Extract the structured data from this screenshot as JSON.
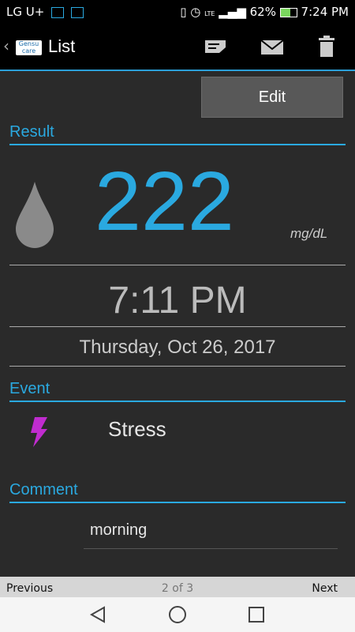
{
  "status_bar": {
    "carrier": "LG U+",
    "network": "LTE",
    "battery": "62%",
    "time": "7:24 PM"
  },
  "action_bar": {
    "back": "‹",
    "logo_line1": "Gensu",
    "logo_line2": "care",
    "title": "List"
  },
  "result": {
    "edit_label": "Edit",
    "header": "Result",
    "value": "222",
    "unit": "mg/dL",
    "time": "7:11 PM",
    "date": "Thursday, Oct 26, 2017"
  },
  "event": {
    "header": "Event",
    "label": "Stress"
  },
  "comment": {
    "header": "Comment",
    "text": "morning"
  },
  "pager": {
    "previous": "Previous",
    "position": "2 of 3",
    "next": "Next"
  },
  "colors": {
    "accent": "#2aa9e0",
    "event_icon": "#c02ccf",
    "drop": "#8a8a8a"
  }
}
